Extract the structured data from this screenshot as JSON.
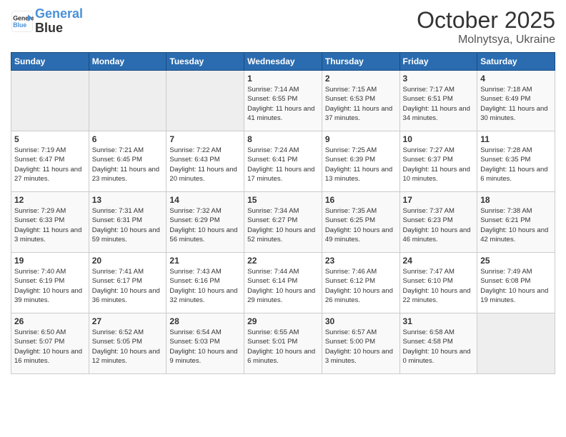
{
  "header": {
    "logo_line1": "General",
    "logo_line2": "Blue",
    "month": "October 2025",
    "location": "Molnytsya, Ukraine"
  },
  "days_of_week": [
    "Sunday",
    "Monday",
    "Tuesday",
    "Wednesday",
    "Thursday",
    "Friday",
    "Saturday"
  ],
  "weeks": [
    [
      {
        "day": "",
        "empty": true
      },
      {
        "day": "",
        "empty": true
      },
      {
        "day": "",
        "empty": true
      },
      {
        "day": "1",
        "sunrise": "7:14 AM",
        "sunset": "6:55 PM",
        "daylight": "11 hours and 41 minutes."
      },
      {
        "day": "2",
        "sunrise": "7:15 AM",
        "sunset": "6:53 PM",
        "daylight": "11 hours and 37 minutes."
      },
      {
        "day": "3",
        "sunrise": "7:17 AM",
        "sunset": "6:51 PM",
        "daylight": "11 hours and 34 minutes."
      },
      {
        "day": "4",
        "sunrise": "7:18 AM",
        "sunset": "6:49 PM",
        "daylight": "11 hours and 30 minutes."
      }
    ],
    [
      {
        "day": "5",
        "sunrise": "7:19 AM",
        "sunset": "6:47 PM",
        "daylight": "11 hours and 27 minutes."
      },
      {
        "day": "6",
        "sunrise": "7:21 AM",
        "sunset": "6:45 PM",
        "daylight": "11 hours and 23 minutes."
      },
      {
        "day": "7",
        "sunrise": "7:22 AM",
        "sunset": "6:43 PM",
        "daylight": "11 hours and 20 minutes."
      },
      {
        "day": "8",
        "sunrise": "7:24 AM",
        "sunset": "6:41 PM",
        "daylight": "11 hours and 17 minutes."
      },
      {
        "day": "9",
        "sunrise": "7:25 AM",
        "sunset": "6:39 PM",
        "daylight": "11 hours and 13 minutes."
      },
      {
        "day": "10",
        "sunrise": "7:27 AM",
        "sunset": "6:37 PM",
        "daylight": "11 hours and 10 minutes."
      },
      {
        "day": "11",
        "sunrise": "7:28 AM",
        "sunset": "6:35 PM",
        "daylight": "11 hours and 6 minutes."
      }
    ],
    [
      {
        "day": "12",
        "sunrise": "7:29 AM",
        "sunset": "6:33 PM",
        "daylight": "11 hours and 3 minutes."
      },
      {
        "day": "13",
        "sunrise": "7:31 AM",
        "sunset": "6:31 PM",
        "daylight": "10 hours and 59 minutes."
      },
      {
        "day": "14",
        "sunrise": "7:32 AM",
        "sunset": "6:29 PM",
        "daylight": "10 hours and 56 minutes."
      },
      {
        "day": "15",
        "sunrise": "7:34 AM",
        "sunset": "6:27 PM",
        "daylight": "10 hours and 52 minutes."
      },
      {
        "day": "16",
        "sunrise": "7:35 AM",
        "sunset": "6:25 PM",
        "daylight": "10 hours and 49 minutes."
      },
      {
        "day": "17",
        "sunrise": "7:37 AM",
        "sunset": "6:23 PM",
        "daylight": "10 hours and 46 minutes."
      },
      {
        "day": "18",
        "sunrise": "7:38 AM",
        "sunset": "6:21 PM",
        "daylight": "10 hours and 42 minutes."
      }
    ],
    [
      {
        "day": "19",
        "sunrise": "7:40 AM",
        "sunset": "6:19 PM",
        "daylight": "10 hours and 39 minutes."
      },
      {
        "day": "20",
        "sunrise": "7:41 AM",
        "sunset": "6:17 PM",
        "daylight": "10 hours and 36 minutes."
      },
      {
        "day": "21",
        "sunrise": "7:43 AM",
        "sunset": "6:16 PM",
        "daylight": "10 hours and 32 minutes."
      },
      {
        "day": "22",
        "sunrise": "7:44 AM",
        "sunset": "6:14 PM",
        "daylight": "10 hours and 29 minutes."
      },
      {
        "day": "23",
        "sunrise": "7:46 AM",
        "sunset": "6:12 PM",
        "daylight": "10 hours and 26 minutes."
      },
      {
        "day": "24",
        "sunrise": "7:47 AM",
        "sunset": "6:10 PM",
        "daylight": "10 hours and 22 minutes."
      },
      {
        "day": "25",
        "sunrise": "7:49 AM",
        "sunset": "6:08 PM",
        "daylight": "10 hours and 19 minutes."
      }
    ],
    [
      {
        "day": "26",
        "sunrise": "6:50 AM",
        "sunset": "5:07 PM",
        "daylight": "10 hours and 16 minutes."
      },
      {
        "day": "27",
        "sunrise": "6:52 AM",
        "sunset": "5:05 PM",
        "daylight": "10 hours and 12 minutes."
      },
      {
        "day": "28",
        "sunrise": "6:54 AM",
        "sunset": "5:03 PM",
        "daylight": "10 hours and 9 minutes."
      },
      {
        "day": "29",
        "sunrise": "6:55 AM",
        "sunset": "5:01 PM",
        "daylight": "10 hours and 6 minutes."
      },
      {
        "day": "30",
        "sunrise": "6:57 AM",
        "sunset": "5:00 PM",
        "daylight": "10 hours and 3 minutes."
      },
      {
        "day": "31",
        "sunrise": "6:58 AM",
        "sunset": "4:58 PM",
        "daylight": "10 hours and 0 minutes."
      },
      {
        "day": "",
        "empty": true
      }
    ]
  ]
}
